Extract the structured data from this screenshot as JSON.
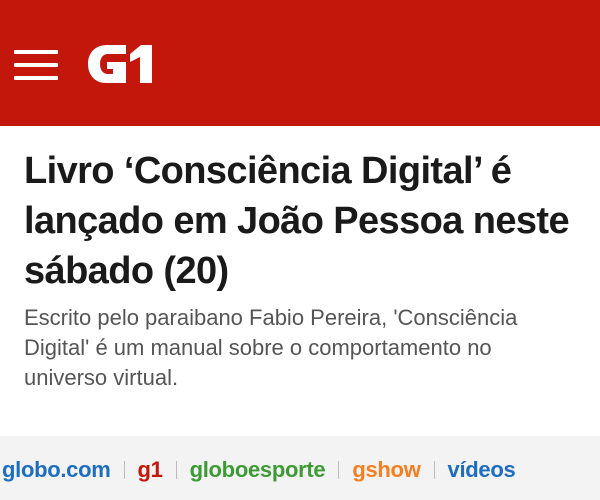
{
  "header": {
    "menu_icon": "hamburger-menu-icon",
    "logo_text": "G1",
    "background_color": "#c4170c"
  },
  "article": {
    "headline": "Livro ‘Consciência Digital’ é lançado em João Pessoa neste sábado (20)",
    "subtitle": "Escrito pelo paraibano Fabio Pereira, 'Consciência Digital' é um manual sobre o comportamento no universo virtual."
  },
  "footer": {
    "links": [
      {
        "label": "globo.com",
        "color": "#1d6ec1"
      },
      {
        "label": "g1",
        "color": "#c4170c"
      },
      {
        "label": "globoesporte",
        "color": "#3d9b35"
      },
      {
        "label": "gshow",
        "color": "#f57e20"
      },
      {
        "label": "vídeos",
        "color": "#1d6ec1"
      }
    ]
  }
}
